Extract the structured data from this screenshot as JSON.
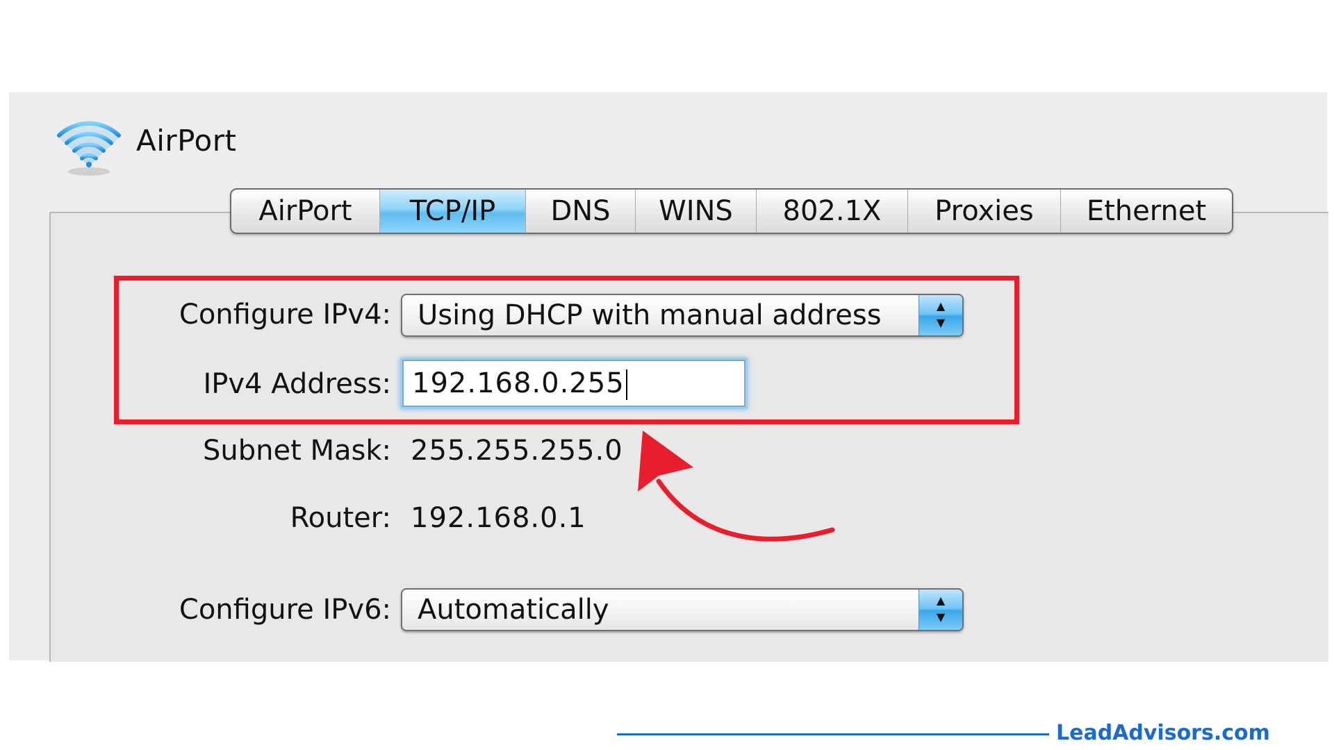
{
  "header": {
    "icon": "wifi-icon",
    "title": "AirPort"
  },
  "tabs": [
    {
      "label": "AirPort",
      "selected": false
    },
    {
      "label": "TCP/IP",
      "selected": true
    },
    {
      "label": "DNS",
      "selected": false
    },
    {
      "label": "WINS",
      "selected": false
    },
    {
      "label": "802.1X",
      "selected": false
    },
    {
      "label": "Proxies",
      "selected": false
    },
    {
      "label": "Ethernet",
      "selected": false
    }
  ],
  "form": {
    "configure_ipv4_label": "Configure IPv4:",
    "configure_ipv4_value": "Using DHCP with manual address",
    "ipv4_address_label": "IPv4 Address:",
    "ipv4_address_value": "192.168.0.255",
    "subnet_mask_label": "Subnet Mask:",
    "subnet_mask_value": "255.255.255.0",
    "router_label": "Router:",
    "router_value": "192.168.0.1",
    "configure_ipv6_label": "Configure IPv6:",
    "configure_ipv6_value": "Automatically"
  },
  "annotation": {
    "highlight_color": "#ea1d2c",
    "arrow_color": "#ea1d2c"
  },
  "footer": {
    "brand": "LeadAdvisors.com",
    "brand_color": "#1a6bd0"
  }
}
